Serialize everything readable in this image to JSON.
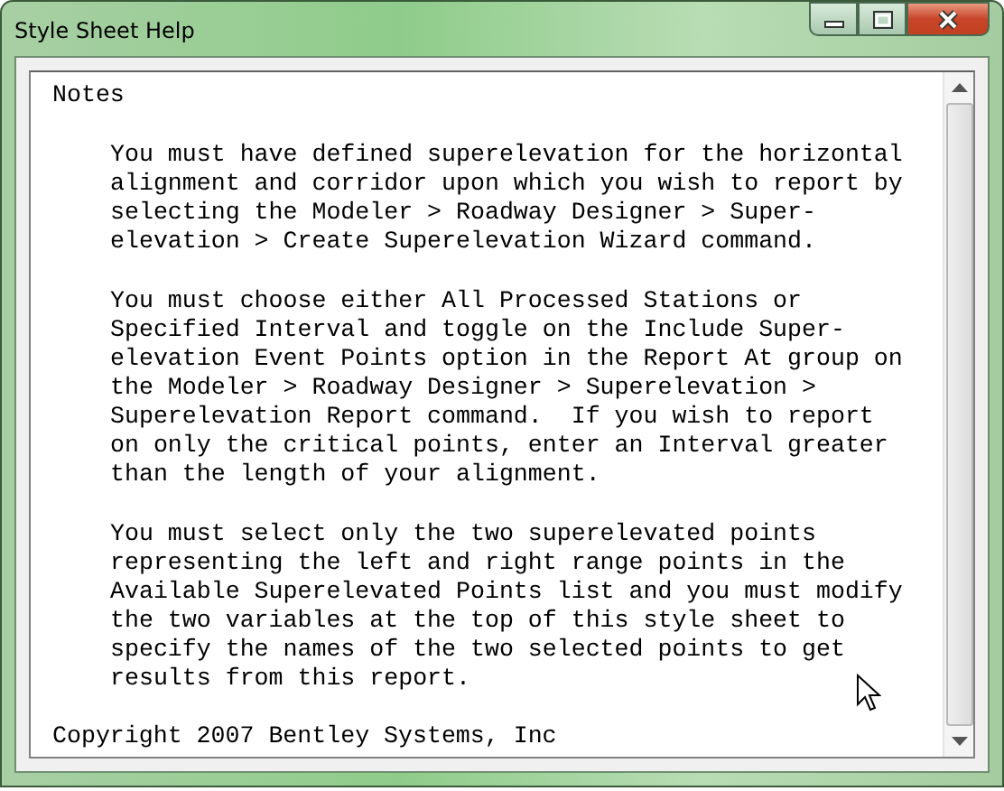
{
  "window": {
    "title": "Style Sheet Help"
  },
  "heading": "Notes",
  "paragraphs": [
    {
      "lines": [
        "You must have defined superelevation for the horizontal",
        "alignment and corridor upon which you wish to report by",
        "selecting the Modeler > Roadway Designer > Super-",
        "elevation > Create Superelevation Wizard command."
      ]
    },
    {
      "lines": [
        "You must choose either All Processed Stations or",
        "Specified Interval and toggle on the Include Super-",
        "elevation Event Points option in the Report At group on",
        "the Modeler > Roadway Designer > Superelevation >",
        "Superelevation Report command.  If you wish to report",
        "on only the critical points, enter an Interval greater",
        "than the length of your alignment."
      ]
    },
    {
      "lines": [
        "You must select only the two superelevated points",
        "representing the left and right range points in the",
        "Available Superelevated Points list and you must modify",
        "the two variables at the top of this style sheet to",
        "specify the names of the two selected points to get",
        "results from this report."
      ]
    }
  ],
  "footer": "Copyright 2007 Bentley Systems, Inc"
}
